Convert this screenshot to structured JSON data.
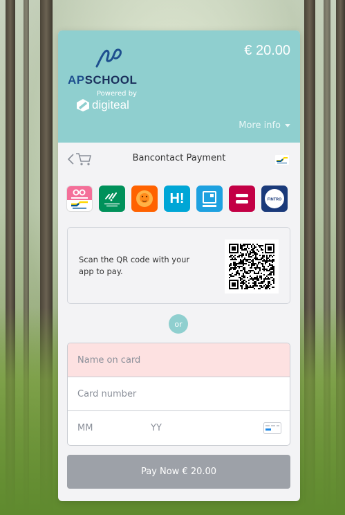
{
  "merchant": {
    "name_part1": "AP",
    "name_part2": "SCH",
    "name_part3": "OOL",
    "powered_by": "Powered by",
    "provider": "digiteal"
  },
  "payment": {
    "amount": "€ 20.00",
    "more_info": "More info",
    "title": "Bancontact Payment"
  },
  "banks": [
    {
      "icon": "payconiq-bancontact-icon",
      "color": "#f46f99"
    },
    {
      "icon": "bnp-paribas-fortis-icon",
      "color": "#00915a",
      "text": "BNP PARIBAS FORTIS"
    },
    {
      "icon": "ing-lion-icon",
      "color": "#ff6200"
    },
    {
      "icon": "hello-bank-icon",
      "color": "#00a6d6",
      "text": "H!"
    },
    {
      "icon": "cbc-icon",
      "color": "#1ea1e0",
      "text": "CBC"
    },
    {
      "icon": "belfius-icon",
      "color": "#c30045"
    },
    {
      "icon": "fintro-icon",
      "color": "#1a3a7a",
      "text": "FINTRO"
    }
  ],
  "qr": {
    "instructions": "Scan the QR code with your app to pay."
  },
  "or_label": "or",
  "form": {
    "name_placeholder": "Name on card",
    "number_placeholder": "Card number",
    "mm_placeholder": "MM",
    "yy_placeholder": "YY"
  },
  "pay_button": "Pay Now € 20.00",
  "colors": {
    "header": "#8fcfcf",
    "error_field": "#fde1e1",
    "pay_button": "#9da1a8",
    "brand_blue": "#1e4f8f"
  }
}
